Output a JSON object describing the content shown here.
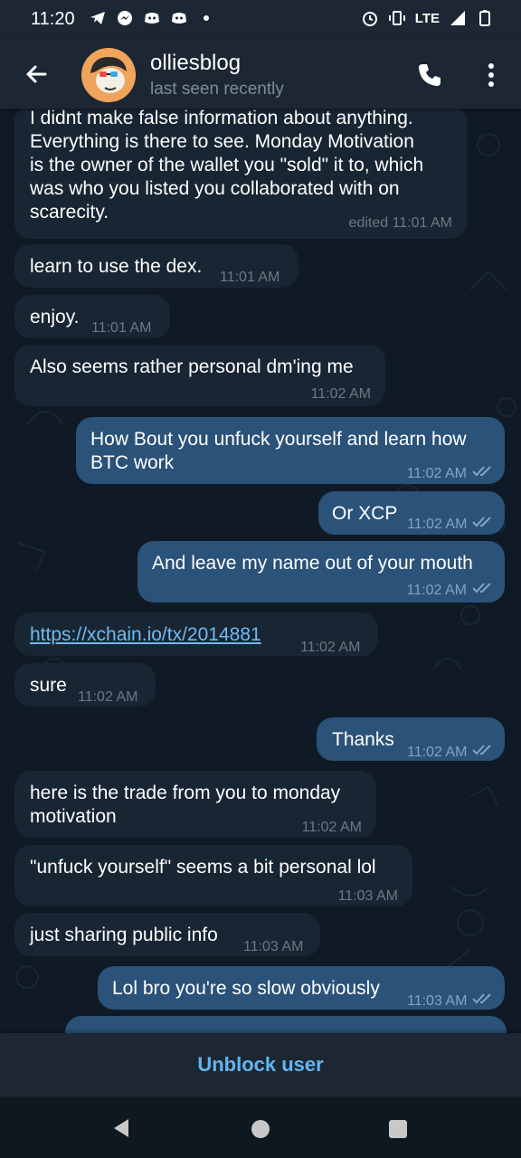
{
  "status_bar": {
    "time": "11:20",
    "network": "LTE"
  },
  "header": {
    "title": "olliesblog",
    "subtitle": "last seen recently"
  },
  "messages": [
    {
      "dir": "in",
      "text": "I didnt make false information about anything.\nEverything is there to see. Monday Motivation\nis the owner of the wallet you \"sold\" it to, which\nwas who you listed you collaborated with on\nscarecity.",
      "time": "edited 11:01 AM"
    },
    {
      "dir": "in",
      "text": "learn to use the dex.",
      "time": "11:01 AM"
    },
    {
      "dir": "in",
      "text": "enjoy.",
      "time": "11:01 AM"
    },
    {
      "dir": "in",
      "text": "Also seems rather personal dm'ing me",
      "time": "11:02 AM"
    },
    {
      "dir": "out",
      "text": "How Bout you unfuck yourself and learn how\nBTC work",
      "time": "11:02 AM"
    },
    {
      "dir": "out",
      "text": "Or XCP",
      "time": "11:02 AM"
    },
    {
      "dir": "out",
      "text": "And leave my name out of your mouth",
      "time": "11:02 AM"
    },
    {
      "dir": "in",
      "text": "https://xchain.io/tx/2014881",
      "time": "11:02 AM"
    },
    {
      "dir": "in",
      "text": "sure",
      "time": "11:02 AM"
    },
    {
      "dir": "out",
      "text": "Thanks",
      "time": "11:02 AM"
    },
    {
      "dir": "in",
      "text": "here is the trade from you to monday\nmotivation",
      "time": "11:02 AM"
    },
    {
      "dir": "in",
      "text": "\"unfuck yourself\" seems a bit personal lol",
      "time": "11:03 AM"
    },
    {
      "dir": "in",
      "text": "just sharing public info",
      "time": "11:03 AM"
    },
    {
      "dir": "out",
      "text": "Lol bro you're so slow obviously",
      "time": "11:03 AM"
    }
  ],
  "bottom": {
    "unblock_label": "Unblock user"
  },
  "colors": {
    "incoming_bubble": "#182533",
    "outgoing_bubble": "#2b5278",
    "accent": "#64b5ef"
  }
}
